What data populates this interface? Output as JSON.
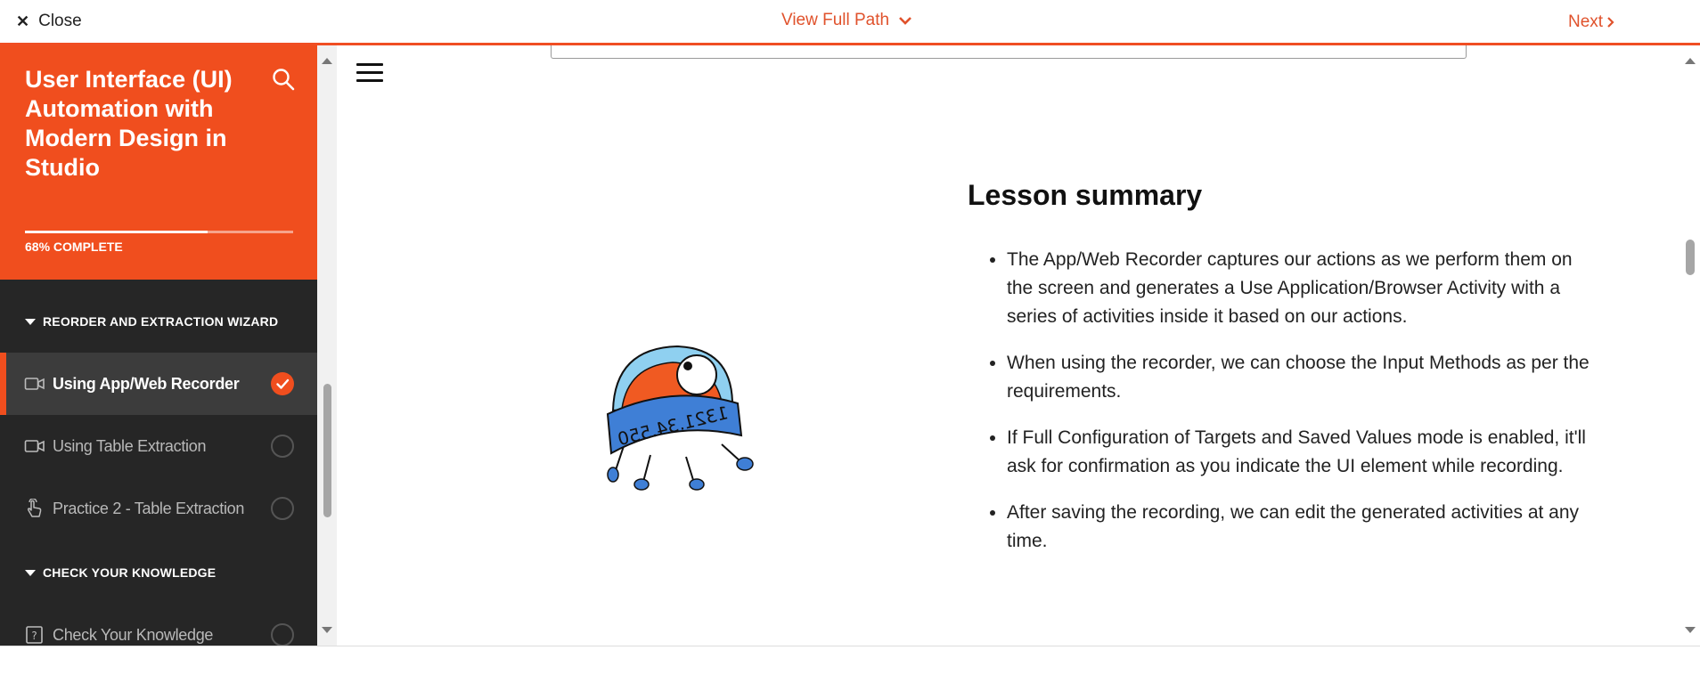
{
  "topbar": {
    "close_label": "Close",
    "view_path_label": "View Full Path",
    "next_label": "Next"
  },
  "course": {
    "title": "User Interface (UI) Automation with Modern Design in Studio",
    "progress_percent": 68,
    "progress_label": "68% COMPLETE"
  },
  "sidebar": {
    "sections": [
      {
        "title": "REORDER AND EXTRACTION WIZARD"
      },
      {
        "title": "CHECK YOUR KNOWLEDGE"
      }
    ],
    "lessons": [
      {
        "label": "Using App/Web Recorder",
        "icon": "video-icon",
        "status": "completed",
        "active": true
      },
      {
        "label": "Using Table Extraction",
        "icon": "video-icon",
        "status": "not-started",
        "active": false
      },
      {
        "label": "Practice 2 - Table Extraction",
        "icon": "hand-pointer-icon",
        "status": "not-started",
        "active": false
      },
      {
        "label": "Check Your Knowledge",
        "icon": "question-icon",
        "status": "not-started",
        "active": false
      }
    ]
  },
  "colors": {
    "accent": "#f04e1e",
    "link": "#e0522c",
    "sidebar_bg": "#262626"
  },
  "content": {
    "summary_title": "Lesson summary",
    "summary_points": [
      "The App/Web Recorder captures our actions as we perform them on the screen and generates a Use Application/Browser Activity with a series of activities inside it based on our actions.",
      "When using the recorder, we can choose the Input Methods as per the requirements.",
      "If Full Configuration of Targets and Saved Values mode is enabled, it'll ask for confirmation as you indicate the UI element while recording.",
      "After saving the recording, we can edit the generated activities at any time."
    ],
    "mascot_text": "1321.34.550"
  }
}
